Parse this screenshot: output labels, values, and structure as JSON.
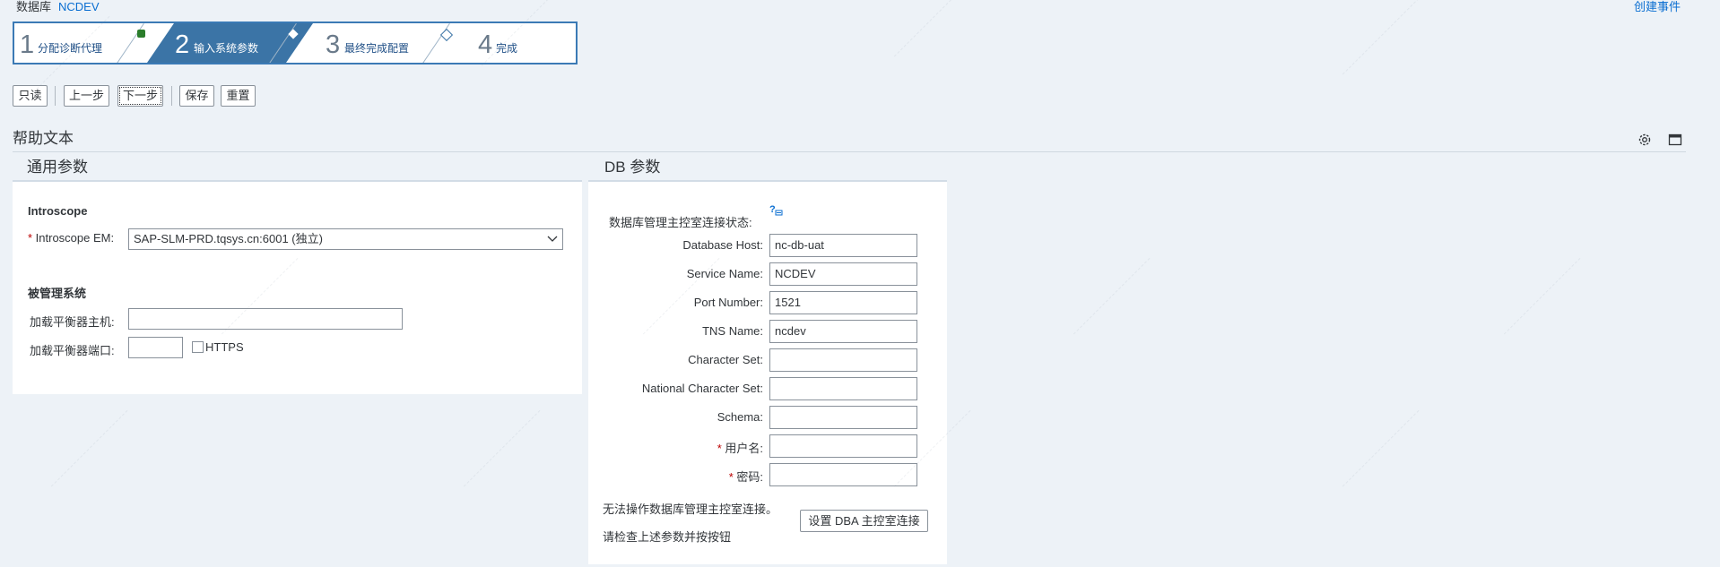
{
  "header": {
    "db_label": "数据库",
    "db_name": "NCDEV",
    "create_event_link": "创建事件"
  },
  "wizard": {
    "steps": [
      {
        "num": "1",
        "label": "分配诊断代理"
      },
      {
        "num": "2",
        "label": "输入系统参数"
      },
      {
        "num": "3",
        "label": "最终完成配置"
      },
      {
        "num": "4",
        "label": "完成"
      }
    ],
    "active_step": 2
  },
  "toolbar": {
    "readonly": "只读",
    "prev": "上一步",
    "next": "下一步",
    "save": "保存",
    "reset": "重置"
  },
  "help_text": {
    "title": "帮助文本",
    "icons": [
      "gear-icon",
      "maximize-icon"
    ]
  },
  "general": {
    "title": "通用参数",
    "introscope_section": "Introscope",
    "introscope_em_label": "Introscope EM:",
    "introscope_em_value": "SAP-SLM-PRD.tqsys.cn:6001 (独立)",
    "managed_section": "被管理系统",
    "lb_host_label": "加载平衡器主机:",
    "lb_host_value": "",
    "lb_port_label": "加载平衡器端口:",
    "lb_port_value": "",
    "https_label": "HTTPS",
    "https_checked": false
  },
  "db": {
    "title": "DB 参数",
    "status_label": "数据库管理主控室连接状态:",
    "fields": [
      {
        "label": "Database Host:",
        "value": "nc-db-uat",
        "required": false
      },
      {
        "label": "Service Name:",
        "value": "NCDEV",
        "required": false
      },
      {
        "label": "Port Number:",
        "value": "1521",
        "required": false
      },
      {
        "label": "TNS Name:",
        "value": "ncdev",
        "required": false
      },
      {
        "label": "Character Set:",
        "value": "",
        "required": false
      },
      {
        "label": "National Character Set:",
        "value": "",
        "required": false
      },
      {
        "label": "Schema:",
        "value": "",
        "required": false
      },
      {
        "label": "用户名:",
        "value": "",
        "required": true
      },
      {
        "label": "密码:",
        "value": "",
        "required": true
      }
    ],
    "message1": "无法操作数据库管理主控室连接。",
    "message2": "请检查上述参数并按按钮",
    "dba_button": "设置 DBA 主控室连接"
  },
  "colors": {
    "background": "#edf2f7",
    "active_step": "#3b74a6",
    "link": "#0a6ed1",
    "required": "#bb0000",
    "status_marker": "#2b7d2b"
  }
}
